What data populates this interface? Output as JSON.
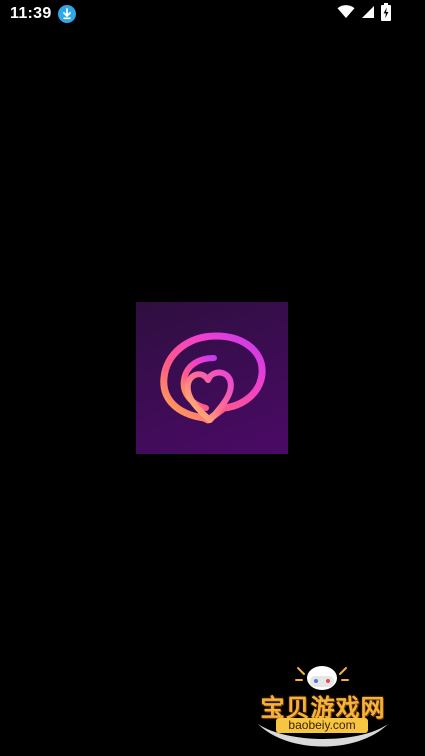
{
  "status_bar": {
    "time": "11:39",
    "download_icon": "download-arrow-icon",
    "wifi_icon": "wifi-icon",
    "signal_icon": "cell-signal-icon",
    "battery_icon": "battery-charging-icon"
  },
  "splash": {
    "logo_icon": "heart-speech-bubble-logo",
    "background": "#000000"
  },
  "watermark": {
    "title": "宝贝游戏网",
    "url": "baobeiy.com",
    "icon": "gamepad-mascot-icon"
  },
  "colors": {
    "download_badge": "#2fa7e8",
    "watermark_text": "#f4b43c",
    "watermark_url_bg": "#f6c542"
  }
}
